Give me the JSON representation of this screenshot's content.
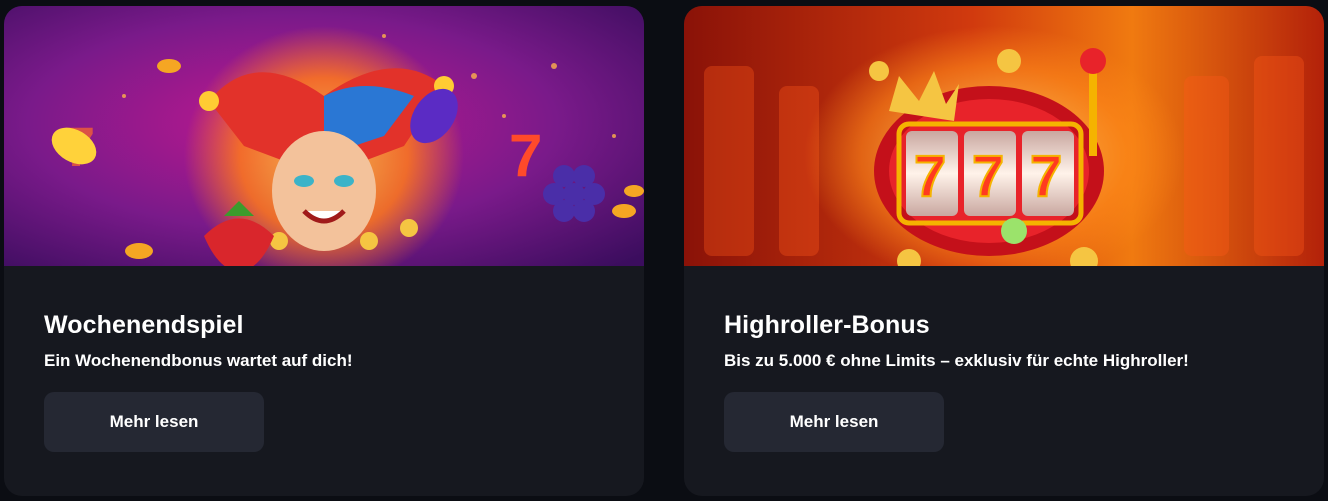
{
  "cards": [
    {
      "title": "Wochenendspiel",
      "description": "Ein Wochenendbonus wartet auf dich!",
      "button_label": "Mehr lesen",
      "banner_icon": "jester-slot-illustration"
    },
    {
      "title": "Highroller-Bonus",
      "description": "Bis zu 5.000 € ohne Limits – exklusiv für echte Highroller!",
      "button_label": "Mehr lesen",
      "banner_icon": "777-slot-machine-illustration"
    }
  ],
  "colors": {
    "page_bg": "#0b0d13",
    "card_bg": "#16181f",
    "button_bg": "#252833",
    "text": "#ffffff"
  }
}
